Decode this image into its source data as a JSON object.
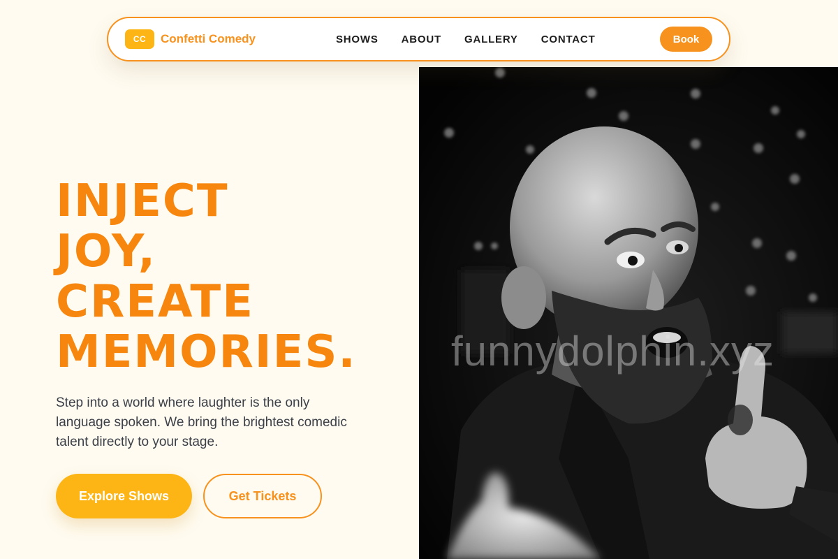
{
  "brand": {
    "mark": "CC",
    "name": "Confetti Comedy"
  },
  "nav": {
    "links": [
      {
        "label": "SHOWS"
      },
      {
        "label": "ABOUT"
      },
      {
        "label": "GALLERY"
      },
      {
        "label": "CONTACT"
      }
    ],
    "cta_label": "Book"
  },
  "hero": {
    "headline_lines": [
      "INJECT",
      "JOY,",
      "CREATE",
      "MEMORIES."
    ],
    "subtext": "Step into a world where laughter is the only language spoken. We bring the brightest comedic talent directly to your stage.",
    "primary_button": "Explore Shows",
    "secondary_button": "Get Tickets"
  },
  "photo": {
    "watermark": "funnydolphin.xyz"
  },
  "colors": {
    "background": "#fffbf0",
    "accent_orange": "#f7921e",
    "accent_yellow": "#fdb515",
    "text_dark": "#1c1c1c",
    "text_body": "#3b3f47"
  }
}
